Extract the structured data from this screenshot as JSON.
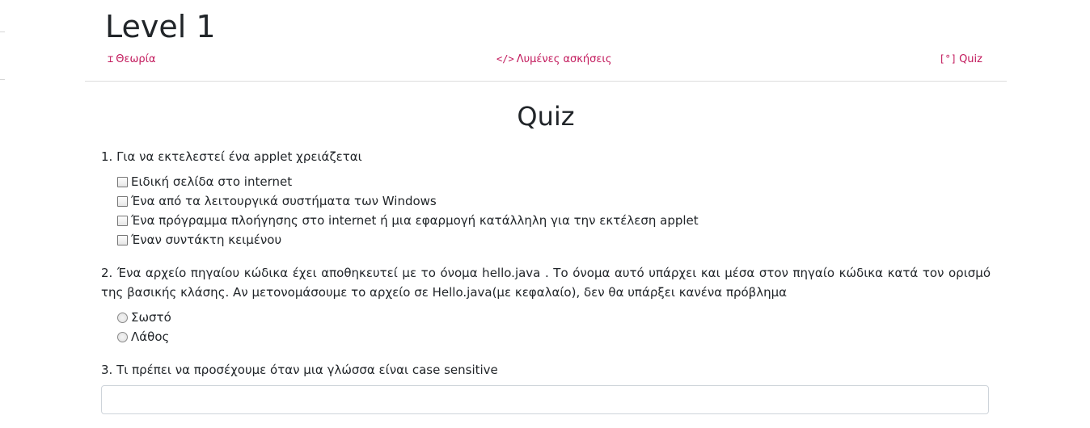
{
  "page_title": "Level 1",
  "nav": {
    "theory": {
      "icon": "book-icon",
      "glyph": "⌶",
      "label": "Θεωρία"
    },
    "solved": {
      "icon": "code-icon",
      "glyph": "</>",
      "label": "Λυμένες ασκήσεις"
    },
    "quiz": {
      "icon": "quiz-icon",
      "glyph": "[°]",
      "label": "Quiz"
    }
  },
  "colors": {
    "link": "#c2185b",
    "text": "#212529",
    "divider": "#dcdcdc",
    "input_border": "#ced4da"
  },
  "quiz": {
    "heading": "Quiz",
    "questions": [
      {
        "text": "1. Για να εκτελεστεί ένα applet χρειάζεται",
        "type": "checkbox",
        "options": [
          "Ειδική σελίδα στο internet",
          "Ένα από τα λειτουργικά συστήματα των Windows",
          "Ένα πρόγραμμα πλοήγησης στο internet ή μια εφαρμογή κατάλληλη για την εκτέλεση applet",
          "Έναν συντάκτη κειμένου"
        ]
      },
      {
        "text": "2. Ένα αρχείο πηγαίου κώδικα έχει αποθηκευτεί με το όνομα hello.java . Το όνομα αυτό υπάρχει και μέσα στον πηγαίο κώδικα κατά τον ορισμό της βασικής κλάσης. Αν μετονομάσουμε το αρχείο σε Hello.java(με κεφαλαίο), δεν θα υπάρξει κανένα πρόβλημα",
        "type": "radio",
        "options": [
          "Σωστό",
          "Λάθος"
        ]
      },
      {
        "text": "3. Τι πρέπει να προσέχουμε όταν μια γλώσσα είναι case sensitive",
        "type": "text",
        "value": "",
        "placeholder": ""
      }
    ]
  }
}
